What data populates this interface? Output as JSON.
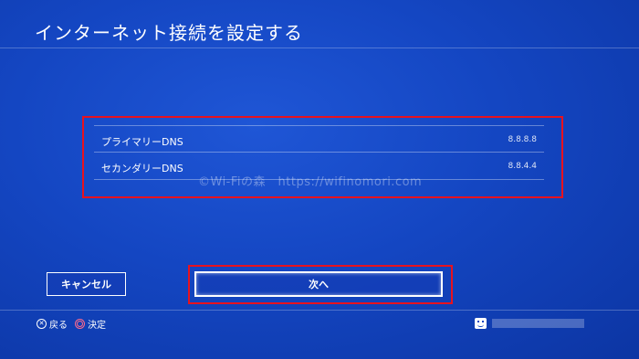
{
  "header": {
    "title": "インターネット接続を設定する"
  },
  "dns": {
    "rows": [
      {
        "label": "プライマリーDNS",
        "value": "8.8.8.8"
      },
      {
        "label": "セカンダリーDNS",
        "value": "8.8.4.4"
      }
    ]
  },
  "watermark": "©Wi-Fiの森　https://wifinomori.com",
  "buttons": {
    "cancel_label": "キャンセル",
    "next_label": "次へ"
  },
  "hints": {
    "back_label": "戻る",
    "confirm_label": "決定"
  },
  "colors": {
    "highlight": "#e8121e",
    "background": "#1446c2"
  },
  "icons": {
    "back": "cross-button-icon",
    "confirm": "circle-button-icon",
    "user": "user-face-icon"
  }
}
